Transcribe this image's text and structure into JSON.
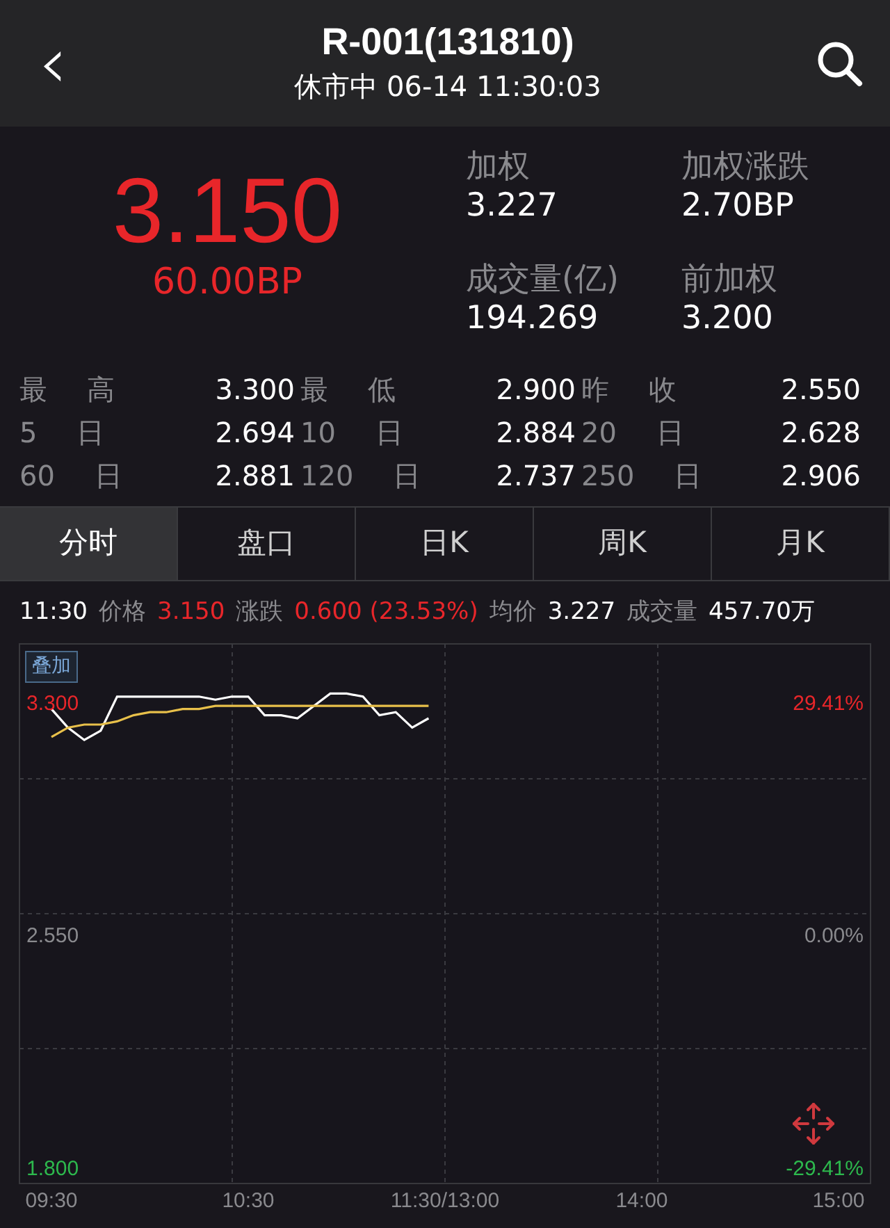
{
  "header": {
    "back": "‹",
    "title": "R-001(131810)",
    "subtitle": "休市中 06-14 11:30:03"
  },
  "quote": {
    "price": "3.150",
    "change": "60.00BP",
    "fields": [
      {
        "label": "加权",
        "value": "3.227"
      },
      {
        "label": "加权涨跌",
        "value": "2.70BP"
      },
      {
        "label": "成交量(亿)",
        "value": "194.269"
      },
      {
        "label": "前加权",
        "value": "3.200"
      }
    ]
  },
  "stats": [
    [
      {
        "label": "最 高",
        "value": "3.300"
      },
      {
        "label": "最 低",
        "value": "2.900"
      },
      {
        "label": "昨 收",
        "value": "2.550"
      }
    ],
    [
      {
        "label": "5 日",
        "value": "2.694"
      },
      {
        "label": "10 日",
        "value": "2.884"
      },
      {
        "label": "20 日",
        "value": "2.628"
      }
    ],
    [
      {
        "label": "60 日",
        "value": "2.881"
      },
      {
        "label": "120 日",
        "value": "2.737"
      },
      {
        "label": "250 日",
        "value": "2.906"
      }
    ]
  ],
  "tabs": [
    {
      "label": "分时",
      "selected": true
    },
    {
      "label": "盘口",
      "selected": false
    },
    {
      "label": "日K",
      "selected": false
    },
    {
      "label": "周K",
      "selected": false
    },
    {
      "label": "月K",
      "selected": false
    }
  ],
  "info_line": [
    {
      "kind": "time",
      "text": "11:30"
    },
    {
      "kind": "label",
      "text": "价格"
    },
    {
      "kind": "up",
      "text": "3.150"
    },
    {
      "kind": "label",
      "text": "涨跌"
    },
    {
      "kind": "up",
      "text": "0.600 (23.53%)"
    },
    {
      "kind": "label",
      "text": "均价"
    },
    {
      "kind": "value",
      "text": "3.227"
    },
    {
      "kind": "label",
      "text": "成交量"
    },
    {
      "kind": "value",
      "text": "457.70万"
    }
  ],
  "chart": {
    "overlay_button": "叠加",
    "percent_labels": [
      {
        "kind": "up",
        "text": "29.41%"
      },
      {
        "kind": "flat",
        "text": "0.00%"
      },
      {
        "kind": "down",
        "text": "-29.41%"
      }
    ],
    "chart_data": {
      "type": "line",
      "categories": [
        "09:30",
        null,
        null,
        null,
        null,
        null,
        null,
        null,
        null,
        null,
        null,
        null,
        "10:30",
        null,
        null,
        null,
        null,
        null,
        null,
        null,
        null,
        null,
        null,
        null,
        "11:30/13:00",
        null,
        null,
        null,
        null,
        null,
        null,
        null,
        null,
        null,
        null,
        null,
        "14:00",
        null,
        null,
        null,
        null,
        null,
        null,
        null,
        null,
        null,
        null,
        null,
        "15:00"
      ],
      "series": [
        {
          "color": "#ffffff",
          "values": [
            3.28,
            3.22,
            3.18,
            3.21,
            3.32,
            3.32,
            3.32,
            3.32,
            3.32,
            3.32,
            3.31,
            3.32,
            3.32,
            3.26,
            3.26,
            3.25,
            3.29,
            3.33,
            3.33,
            3.32,
            3.26,
            3.27,
            3.22,
            3.25,
            null,
            null,
            null,
            null,
            null,
            null,
            null,
            null,
            null,
            null,
            null,
            null,
            null,
            null,
            null,
            null,
            null,
            null,
            null,
            null,
            null,
            null,
            null,
            null,
            null
          ]
        },
        {
          "color": "#e8c04a",
          "values": [
            3.19,
            3.22,
            3.23,
            3.23,
            3.24,
            3.26,
            3.27,
            3.27,
            3.28,
            3.28,
            3.29,
            3.29,
            3.29,
            3.29,
            3.29,
            3.29,
            3.29,
            3.29,
            3.29,
            3.29,
            3.29,
            3.29,
            3.29,
            3.29,
            null,
            null,
            null,
            null,
            null,
            null,
            null,
            null,
            null,
            null,
            null,
            null,
            null,
            null,
            null,
            null,
            null,
            null,
            null,
            null,
            null,
            null,
            null,
            null,
            null
          ]
        }
      ],
      "grid": true,
      "ylim": [
        1.75,
        3.49
      ],
      "yticks": [
        {
          "value": 1.8,
          "label": "1.800"
        },
        {
          "value": 2.55,
          "label": "2.550"
        },
        {
          "value": 3.3,
          "label": "3.300"
        }
      ]
    }
  }
}
